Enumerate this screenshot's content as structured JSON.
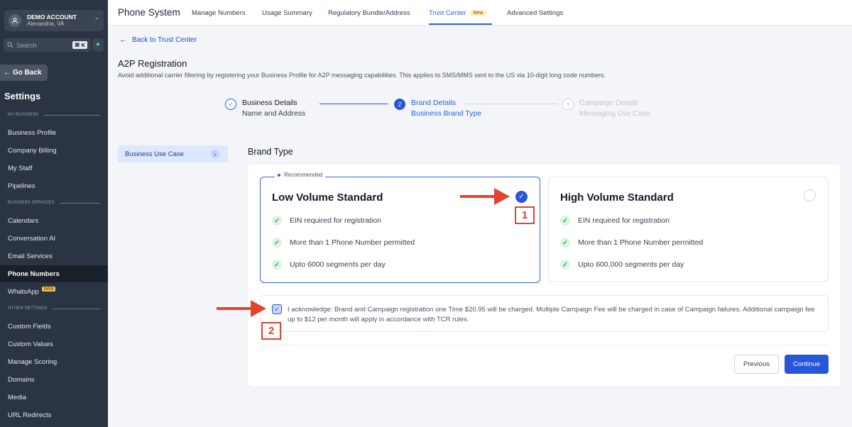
{
  "sidebar": {
    "account": {
      "name": "DEMO ACCOUNT",
      "location": "Alexandria, VA"
    },
    "search": {
      "placeholder": "Search",
      "shortcut": "⌘ K"
    },
    "go_back": "Go Back",
    "title": "Settings",
    "sections": [
      {
        "header": "MY BUSINESS",
        "items": [
          "Business Profile",
          "Company Billing",
          "My Staff",
          "Pipelines"
        ]
      },
      {
        "header": "BUSINESS SERVICES",
        "items": [
          "Calendars",
          "Conversation AI",
          "Email Services",
          "Phone Numbers",
          "WhatsApp"
        ]
      },
      {
        "header": "OTHER SETTINGS",
        "items": [
          "Custom Fields",
          "Custom Values",
          "Manage Scoring",
          "Domains",
          "Media",
          "URL Redirects"
        ]
      }
    ],
    "active_item": "Phone Numbers",
    "beta_label": "beta"
  },
  "topbar": {
    "title": "Phone System",
    "tabs": [
      "Manage Numbers",
      "Usage Summary",
      "Regulatory Bundle/Address",
      "Trust Center",
      "Advanced Settings"
    ],
    "active_tab": "Trust Center",
    "new_badge": "New"
  },
  "main": {
    "back_link": "Back to Trust Center",
    "title": "A2P Registration",
    "subtitle": "Avoid additional carrier filtering by registering your Business Profile for A2P messaging capabilities. This applies to SMS/MMS sent to the US via 10-digit long code numbers.",
    "steps": [
      {
        "title": "Business Details",
        "desc": "Name and Address",
        "state": "complete"
      },
      {
        "number": "2",
        "title": "Brand Details",
        "desc": "Business Brand Type",
        "state": "active"
      },
      {
        "number": "3",
        "title": "Campaign Details",
        "desc": "Messaging Use Case",
        "state": "upcoming"
      }
    ],
    "left_tab": "Business Use Case",
    "section_title": "Brand Type",
    "cards": [
      {
        "badge": "Recommended",
        "title": "Low Volume Standard",
        "selected": true,
        "features": [
          "EIN required for registration",
          "More than 1 Phone Number permitted",
          "Upto 6000 segments per day"
        ]
      },
      {
        "title": "High Volume Standard",
        "selected": false,
        "features": [
          "EIN required for registration",
          "More than 1 Phone Number permitted",
          "Upto 600,000 segments per day"
        ]
      }
    ],
    "acknowledge": {
      "checked": true,
      "text": "I acknowledge: Brand and Campaign registration one Time $20.95 will be charged. Multiple Campaign Fee will be charged in case of Campaign failures. Additional campaign fee up to $12 per month will apply in accordance with TCR rules."
    },
    "buttons": {
      "previous": "Previous",
      "continue": "Continue"
    }
  },
  "annotations": [
    {
      "label": "1"
    },
    {
      "label": "2"
    }
  ],
  "colors": {
    "accent": "#2856d8",
    "sidebar": "#2a3442",
    "annotation": "#e2442f",
    "check_green": "#16a34a"
  }
}
